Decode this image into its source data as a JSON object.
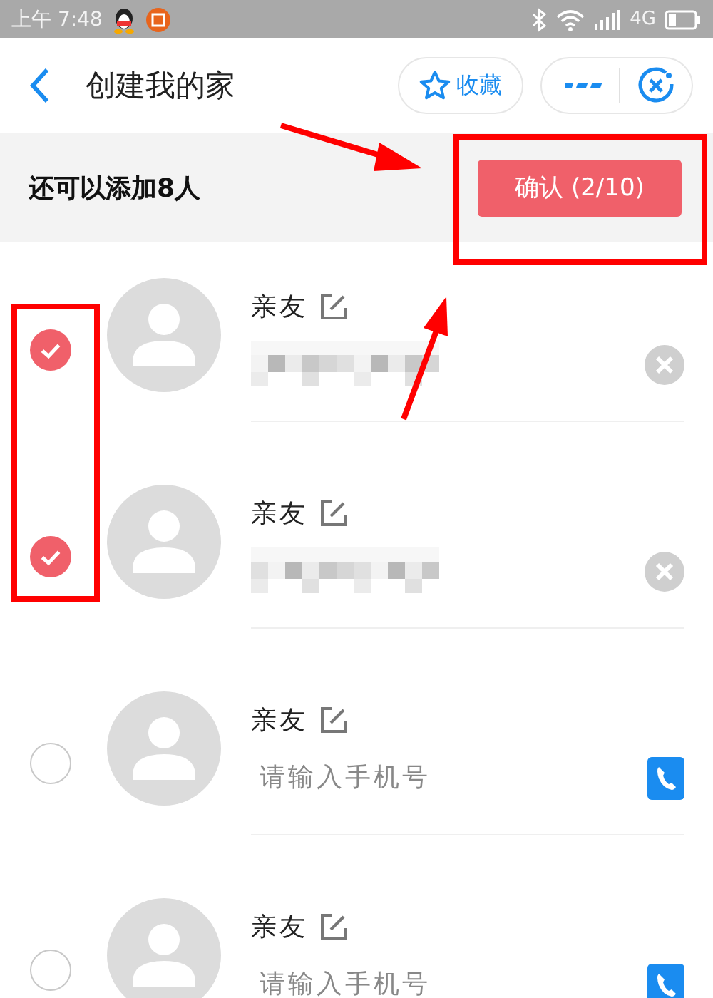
{
  "status_bar": {
    "time": "上午 7:48",
    "network": "4G"
  },
  "header": {
    "title": "创建我的家",
    "favorite_label": "收藏"
  },
  "subbar": {
    "remaining": "还可以添加8人",
    "confirm": "确认 (2/10)"
  },
  "members": [
    {
      "kind": "filled",
      "label": "亲友",
      "selected": true
    },
    {
      "kind": "filled",
      "label": "亲友",
      "selected": true
    },
    {
      "kind": "empty",
      "label": "亲友",
      "selected": false,
      "placeholder": "请输入手机号"
    },
    {
      "kind": "empty",
      "label": "亲友",
      "selected": false,
      "placeholder": "请输入手机号"
    }
  ]
}
